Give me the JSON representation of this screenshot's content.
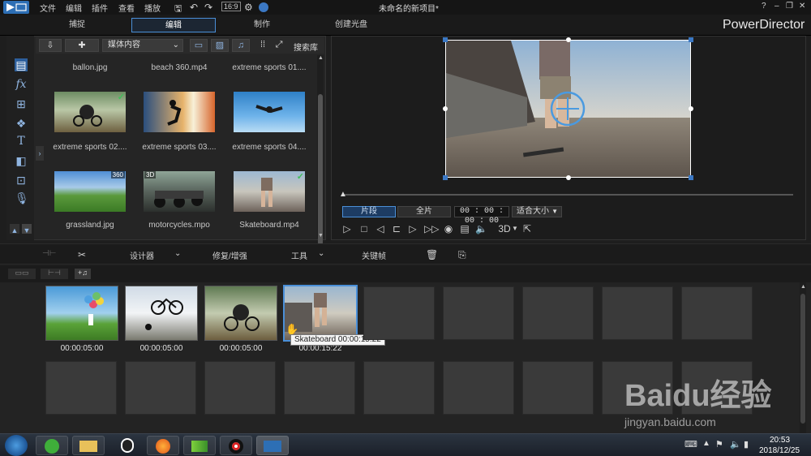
{
  "menu": {
    "file": "文件",
    "edit": "编辑",
    "plugins": "插件",
    "view": "查看",
    "play": "播放"
  },
  "window_title": "未命名的新项目*",
  "win_controls": {
    "help": "?",
    "minimize": "–",
    "restore": "❐",
    "close": "✕"
  },
  "modes": {
    "capture": "捕捉",
    "edit": "编辑",
    "produce": "制作",
    "disc": "创建光盘"
  },
  "brand": "PowerDirector",
  "library": {
    "content_dropdown": "媒体内容",
    "search_label": "搜索库",
    "items": [
      {
        "label": "ballon.jpg"
      },
      {
        "label": "beach 360.mp4"
      },
      {
        "label": "extreme sports 01...."
      },
      {
        "label": "extreme sports 02....",
        "checked": true
      },
      {
        "label": "extreme sports 03...."
      },
      {
        "label": "extreme sports 04...."
      },
      {
        "label": "grassland.jpg",
        "badge": "360"
      },
      {
        "label": "motorcycles.mpo",
        "badge": "3D"
      },
      {
        "label": "Skateboard.mp4",
        "checked": true
      }
    ]
  },
  "preview": {
    "clip_tab": "片段",
    "movie_tab": "全片",
    "timecode": "00 : 00 : 00 : 00",
    "fit_dropdown": "适合大小",
    "three_d": "3D"
  },
  "edit_toolbar": {
    "designer": "设计器",
    "fix_enhance": "修复/增强",
    "tools": "工具",
    "keyframe": "关键帧"
  },
  "storyboard": {
    "clips": [
      {
        "duration": "00:00:05:00"
      },
      {
        "duration": "00:00:05:00"
      },
      {
        "duration": "00:00:05:00"
      },
      {
        "duration": "00:00:15:22"
      }
    ],
    "tooltip": "Skateboard 00:00:15:22"
  },
  "watermark": {
    "brand": "Baidu经验",
    "url": "jingyan.baidu.com"
  },
  "clock": {
    "time": "20:53",
    "date": "2018/12/25"
  },
  "colors": {
    "accent": "#4a8fd8",
    "check": "#3fbf5a"
  }
}
